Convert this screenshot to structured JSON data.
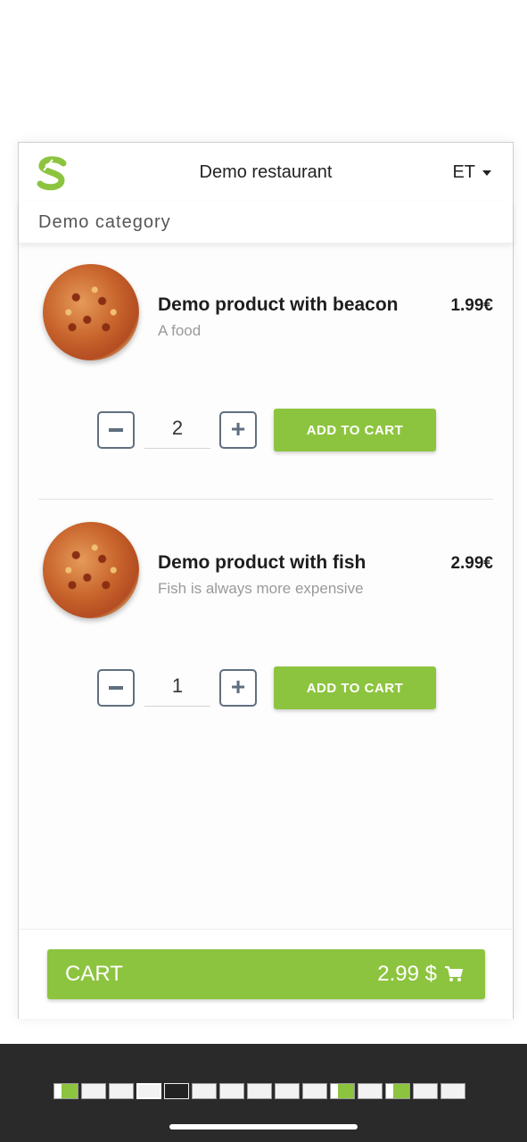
{
  "header": {
    "title": "Demo restaurant",
    "language": "ET"
  },
  "category": {
    "name": "Demo category"
  },
  "products": [
    {
      "name": "Demo product with beacon",
      "description": "A food",
      "price": "1.99€",
      "quantity": "2",
      "add_label": "ADD TO CART"
    },
    {
      "name": "Demo product with fish",
      "description": "Fish is always more expensive",
      "price": "2.99€",
      "quantity": "1",
      "add_label": "ADD TO CART"
    }
  ],
  "cart": {
    "label": "CART",
    "total": "2.99 $"
  },
  "colors": {
    "accent": "#8dc43f",
    "stepper_border": "#5f6f7f"
  },
  "icons": [
    "logo-icon",
    "caret-down-icon",
    "minus-icon",
    "plus-icon",
    "cart-icon"
  ]
}
